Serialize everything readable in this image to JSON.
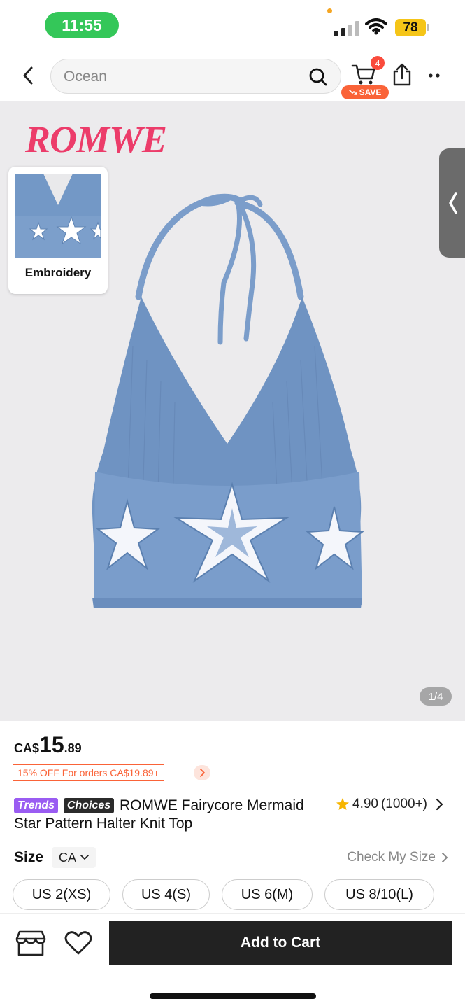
{
  "status_bar": {
    "time": "11:55",
    "battery": "78",
    "colors": {
      "time_pill": "#34c759",
      "battery": "#f5c518"
    }
  },
  "nav": {
    "back_icon": "chevron-left-icon",
    "search_placeholder": "Ocean",
    "search_icon": "search-icon",
    "cart_count": "4",
    "save_label": "SAVE",
    "share_icon": "share-icon",
    "more_icon": "more-icon"
  },
  "gallery": {
    "brand": "ROMWE",
    "thumbnail_label": "Embroidery",
    "page_counter": "1/4",
    "side_tab_icon": "chevron-left-icon",
    "colors": {
      "brand": "#ec3c6a",
      "garment": "#6f93c2",
      "background": "#ecebed"
    }
  },
  "product": {
    "price_currency": "CA$",
    "price_int": "15",
    "price_dec": ".89",
    "promo": "15% OFF For orders CA$19.89+",
    "badges": {
      "trends": "Trends",
      "choices": "Choices"
    },
    "title": "ROMWE Fairycore Mermaid Star Pattern Halter Knit Top",
    "rating": "4.90",
    "rating_count": "(1000+)"
  },
  "size": {
    "label": "Size",
    "unit": "CA",
    "check_label": "Check My Size",
    "options": [
      "US 2(XS)",
      "US 4(S)",
      "US 6(M)",
      "US 8/10(L)"
    ]
  },
  "bottom": {
    "store_icon": "store-icon",
    "wishlist_icon": "heart-icon",
    "add_to_cart": "Add to Cart",
    "colors": {
      "cta": "#222222",
      "accent": "#fa6338"
    }
  }
}
